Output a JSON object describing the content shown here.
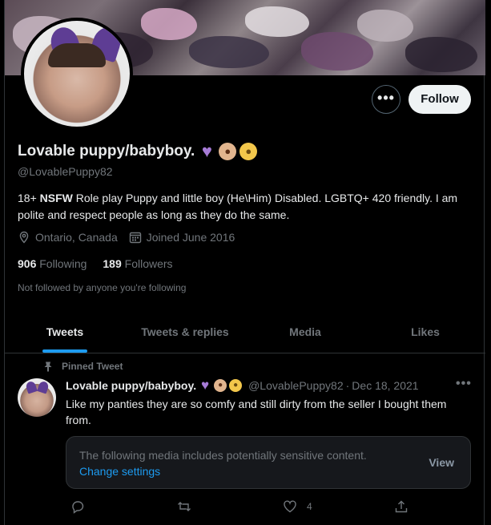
{
  "profile": {
    "display_name": "Lovable puppy/babyboy.",
    "name_emojis": [
      "purple-heart",
      "dog-face",
      "baby-face"
    ],
    "handle": "@LovablePuppy82",
    "bio_prefix": "18+ ",
    "bio_bold": "NSFW",
    "bio_suffix": " Role play Puppy and little boy (He\\Him) Disabled. LGBTQ+ 420 friendly.  I am polite and respect people as long as they do the same.",
    "location": "Ontario, Canada",
    "joined": "Joined June 2016",
    "following_count": "906",
    "following_label": "Following",
    "followers_count": "189",
    "followers_label": "Followers",
    "not_followed_text": "Not followed by anyone you're following",
    "follow_button": "Follow",
    "more_button": "•••"
  },
  "tabs": [
    {
      "label": "Tweets",
      "active": true
    },
    {
      "label": "Tweets & replies",
      "active": false
    },
    {
      "label": "Media",
      "active": false
    },
    {
      "label": "Likes",
      "active": false
    }
  ],
  "tweet": {
    "pinned_label": "Pinned Tweet",
    "author_name": "Lovable puppy/babyboy.",
    "author_handle": "@LovablePuppy82",
    "separator": "·",
    "date": "Dec 18, 2021",
    "text": "Like my panties they are so comfy and still dirty from the seller I bought them from.",
    "sensitive_message": "The following media includes potentially sensitive content.",
    "change_settings": "Change settings",
    "view_label": "View",
    "like_count": "4",
    "more": "•••"
  },
  "colors": {
    "accent": "#1d9bf0",
    "background": "#000000",
    "secondary_text": "#71767b",
    "heart_emoji": "#a67bd6"
  }
}
